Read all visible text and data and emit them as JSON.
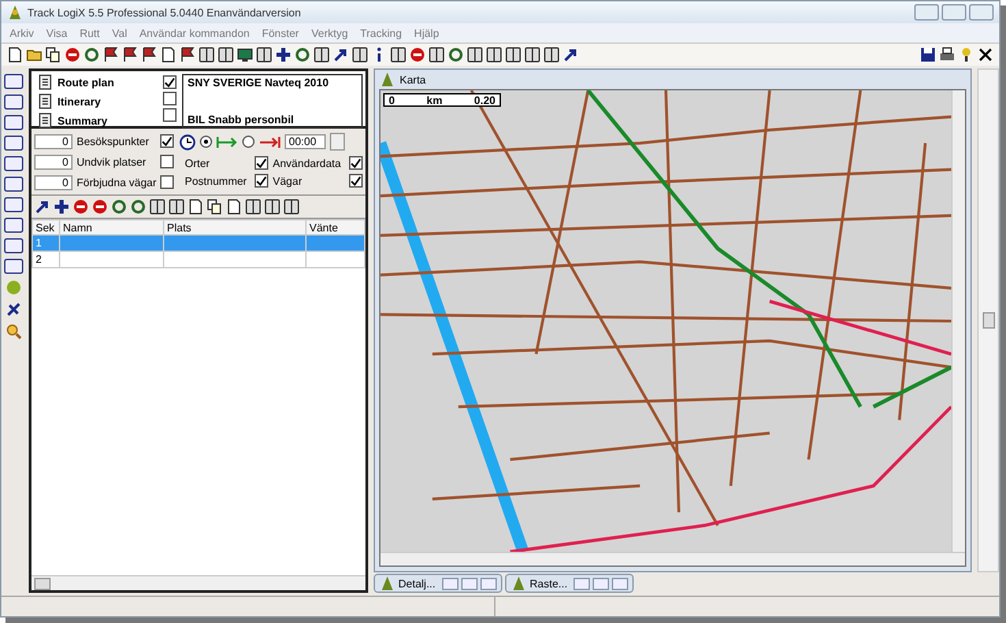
{
  "window": {
    "title": "Track LogiX 5.5 Professional 5.0440 Enanvändarversion"
  },
  "menu": [
    {
      "label": "Arkiv"
    },
    {
      "label": "Visa"
    },
    {
      "label": "Rutt"
    },
    {
      "label": "Val"
    },
    {
      "label": "Användar kommandon"
    },
    {
      "label": "Fönster"
    },
    {
      "label": "Verktyg"
    },
    {
      "label": "Tracking"
    },
    {
      "label": "Hjälp"
    }
  ],
  "left_panel": {
    "reports": [
      {
        "label": "Route plan"
      },
      {
        "label": "Itinerary"
      },
      {
        "label": "Summary"
      }
    ],
    "map_options": [
      {
        "label": "SNY SVERIGE Navteq 2010",
        "checked": true
      },
      {
        "checked": false
      },
      {
        "label": "BIL Snabb personbil",
        "checked": false
      }
    ],
    "point_filters": [
      {
        "count": "0",
        "label": "Besökspunkter",
        "checked": true
      },
      {
        "count": "0",
        "label": "Undvik platser",
        "checked": false
      },
      {
        "count": "0",
        "label": "Förbjudna vägar",
        "checked": false
      }
    ],
    "direction_radios": [
      {
        "selected": true
      },
      {
        "selected": false
      }
    ],
    "time": "00:00",
    "layers": [
      {
        "label": "Orter",
        "checked": true
      },
      {
        "label": "Användardata",
        "checked": true
      },
      {
        "label": "Postnummer",
        "checked": true
      },
      {
        "label": "Vägar",
        "checked": true
      }
    ],
    "table": {
      "columns": [
        "Sek",
        "Namn",
        "Plats",
        "Vänte"
      ],
      "rows": [
        {
          "sek": "1",
          "selected": true
        },
        {
          "sek": "2",
          "selected": false
        }
      ]
    }
  },
  "map_window": {
    "title": "Karta",
    "scale": {
      "start": "0",
      "unit": "km",
      "end": "0.20"
    }
  },
  "minimized_windows": [
    {
      "title": "Detalj..."
    },
    {
      "title": "Raste..."
    }
  ]
}
